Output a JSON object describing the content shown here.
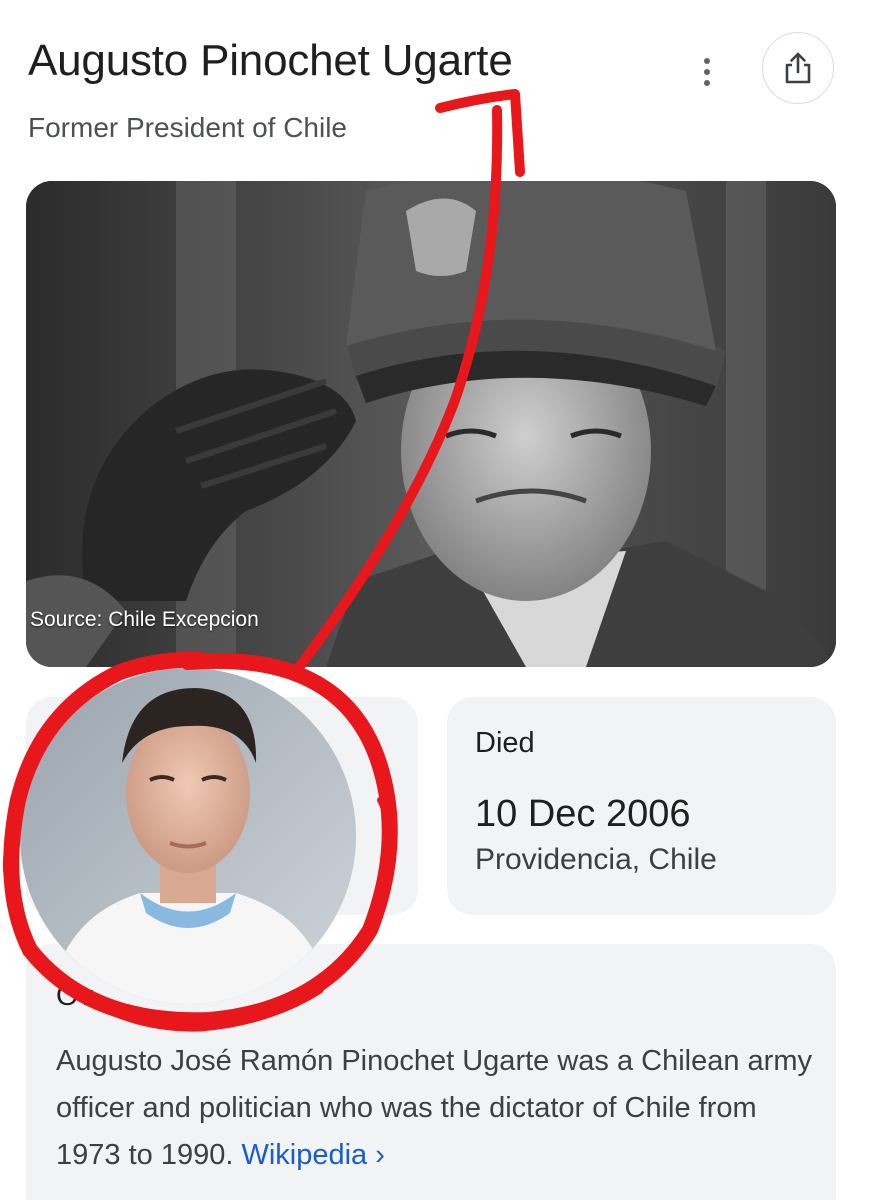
{
  "header": {
    "title": "Augusto Pinochet Ugarte",
    "subtitle": "Former President of Chile",
    "more_icon": "more-vert-icon",
    "share_icon": "share-icon"
  },
  "photo": {
    "source": "Source: Chile Excepcion",
    "image_button_icon": "image-icon"
  },
  "died": {
    "label": "Died",
    "date": "10 Dec 2006",
    "place": "Providencia, Chile"
  },
  "overview": {
    "heading": "Ov",
    "text": "Augusto José Ramón Pinochet Ugarte was a Chilean army officer and politician who was the dictator of Chile from 1973 to 1990.",
    "link_label": "Wikipedia",
    "link_chevron": "›"
  },
  "colors": {
    "annotation_red": "#e8171b",
    "link_blue": "#1a5dc9",
    "card_bg": "#f1f3f4"
  }
}
